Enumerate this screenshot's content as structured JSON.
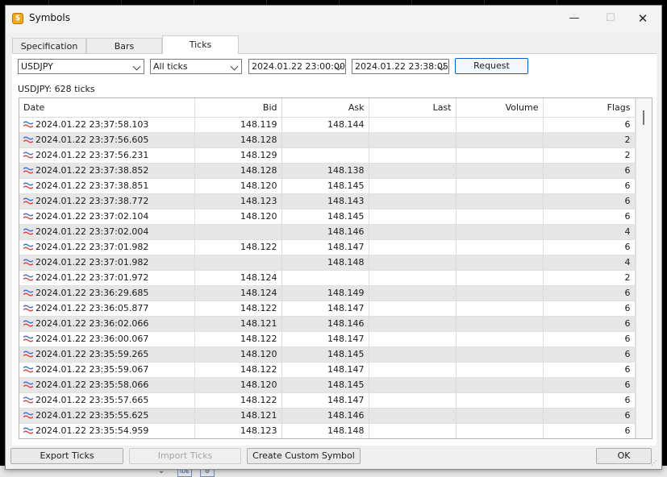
{
  "window": {
    "title": "Symbols",
    "app_icon": "$",
    "minimize_icon": "—",
    "maximize_icon": "☐",
    "close_icon": "✕"
  },
  "tabs": [
    {
      "label": "Specification",
      "active": false
    },
    {
      "label": "Bars",
      "active": false
    },
    {
      "label": "Ticks",
      "active": true
    }
  ],
  "filters": {
    "symbol": "USDJPY",
    "tick_type": "All ticks",
    "date_from": "2024.01.22 23:00:00",
    "date_to": "2024.01.22 23:38:05",
    "request_label": "Request"
  },
  "summary": "USDJPY: 628 ticks",
  "table": {
    "columns": [
      "Date",
      "Bid",
      "Ask",
      "Last",
      "Volume",
      "Flags"
    ],
    "rows": [
      [
        "2024.01.22 23:37:58.103",
        "148.119",
        "148.144",
        "",
        "",
        "6"
      ],
      [
        "2024.01.22 23:37:56.605",
        "148.128",
        "",
        "",
        "",
        "2"
      ],
      [
        "2024.01.22 23:37:56.231",
        "148.129",
        "",
        "",
        "",
        "2"
      ],
      [
        "2024.01.22 23:37:38.852",
        "148.128",
        "148.138",
        "",
        "",
        "6"
      ],
      [
        "2024.01.22 23:37:38.851",
        "148.120",
        "148.145",
        "",
        "",
        "6"
      ],
      [
        "2024.01.22 23:37:38.772",
        "148.123",
        "148.143",
        "",
        "",
        "6"
      ],
      [
        "2024.01.22 23:37:02.104",
        "148.120",
        "148.145",
        "",
        "",
        "6"
      ],
      [
        "2024.01.22 23:37:02.004",
        "",
        "148.146",
        "",
        "",
        "4"
      ],
      [
        "2024.01.22 23:37:01.982",
        "148.122",
        "148.147",
        "",
        "",
        "6"
      ],
      [
        "2024.01.22 23:37:01.982",
        "",
        "148.148",
        "",
        "",
        "4"
      ],
      [
        "2024.01.22 23:37:01.972",
        "148.124",
        "",
        "",
        "",
        "2"
      ],
      [
        "2024.01.22 23:36:29.685",
        "148.124",
        "148.149",
        "",
        "",
        "6"
      ],
      [
        "2024.01.22 23:36:05.877",
        "148.122",
        "148.147",
        "",
        "",
        "6"
      ],
      [
        "2024.01.22 23:36:02.066",
        "148.121",
        "148.146",
        "",
        "",
        "6"
      ],
      [
        "2024.01.22 23:36:00.067",
        "148.122",
        "148.147",
        "",
        "",
        "6"
      ],
      [
        "2024.01.22 23:35:59.265",
        "148.120",
        "148.145",
        "",
        "",
        "6"
      ],
      [
        "2024.01.22 23:35:59.067",
        "148.122",
        "148.147",
        "",
        "",
        "6"
      ],
      [
        "2024.01.22 23:35:58.066",
        "148.120",
        "148.145",
        "",
        "",
        "6"
      ],
      [
        "2024.01.22 23:35:57.665",
        "148.122",
        "148.147",
        "",
        "",
        "6"
      ],
      [
        "2024.01.22 23:35:55.625",
        "148.121",
        "148.146",
        "",
        "",
        "6"
      ],
      [
        "2024.01.22 23:35:54.959",
        "148.123",
        "148.148",
        "",
        "",
        "6"
      ]
    ]
  },
  "buttons": {
    "export": "Export Ticks",
    "import": "Import Ticks",
    "custom": "Create Custom Symbol",
    "ok": "OK"
  },
  "background": {
    "icon1": "IDE",
    "icon2": "⚙"
  },
  "colors": {
    "accent": "#0a5fcf",
    "row_alt": "#e6e6e6",
    "tick_icon_blue": "#3a6fd8",
    "tick_icon_red": "#e0443a"
  }
}
